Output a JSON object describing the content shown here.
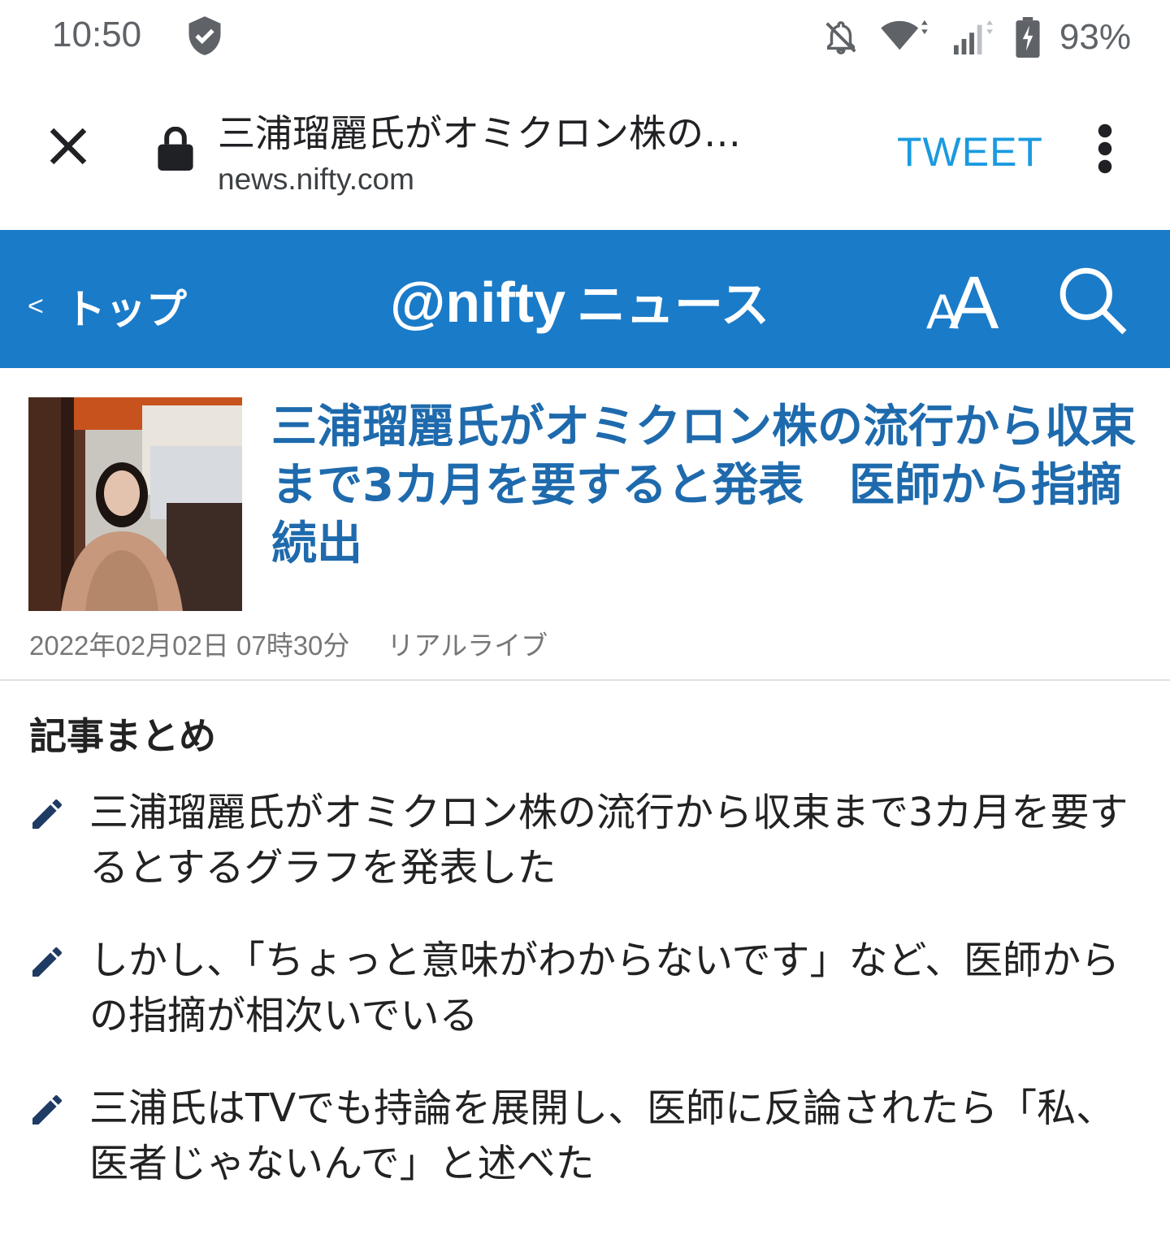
{
  "status_bar": {
    "time": "10:50",
    "battery_percent": "93%"
  },
  "toolbar": {
    "title": "三浦瑠麗氏がオミクロン株の…",
    "url": "news.nifty.com",
    "tweet_label": "TWEET"
  },
  "site_header": {
    "back_label": "トップ",
    "logo_at": "@nifty",
    "logo_news": "ニュース",
    "brand_color": "#1a7bc9"
  },
  "article": {
    "headline": "三浦瑠麗氏がオミクロン株の流行から収束まで3カ月を要すると発表　医師から指摘続出",
    "date": "2022年02月02日 07時30分",
    "source": "リアルライブ"
  },
  "summary": {
    "title": "記事まとめ",
    "items": [
      "三浦瑠麗氏がオミクロン株の流行から収束まで3カ月を要するとするグラフを発表した",
      "しかし、「ちょっと意味がわからないです」など、医師からの指摘が相次いでいる",
      "三浦氏はTVでも持論を展開し、医師に反論されたら「私、医者じゃないんで」と述べた"
    ]
  }
}
